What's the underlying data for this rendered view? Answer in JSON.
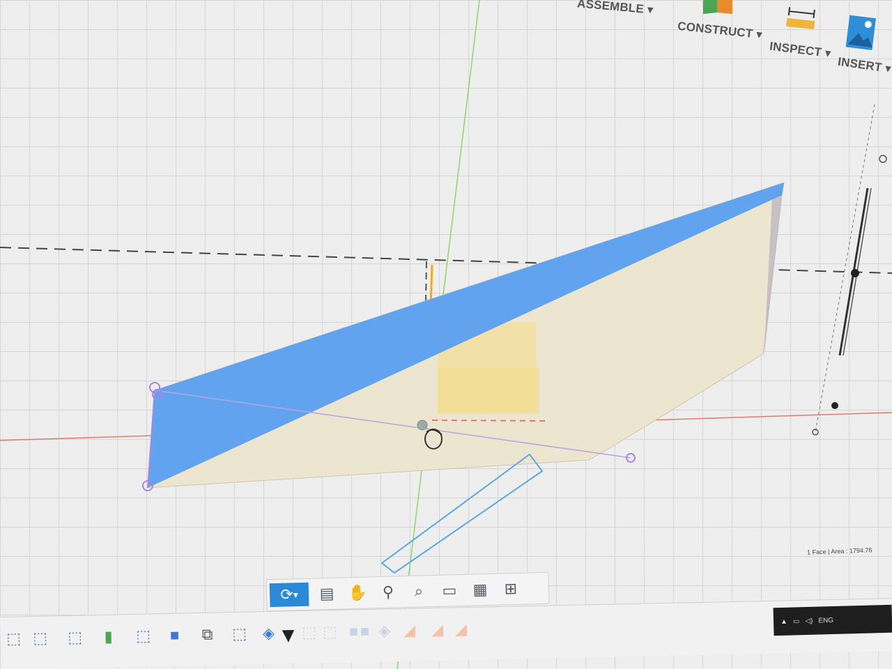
{
  "ribbon": {
    "items": [
      {
        "label": "ASSEMBLE",
        "icon": "assemble-icon"
      },
      {
        "label": "CONSTRUCT",
        "icon": "construct-plane-icon"
      },
      {
        "label": "INSPECT",
        "icon": "measure-ruler-icon"
      },
      {
        "label": "INSERT",
        "icon": "insert-image-icon"
      }
    ],
    "dropdown_glyph": "▾"
  },
  "viewport": {
    "status_text": "1 Face | Area : 1794.76",
    "colors": {
      "highlight_face": "#5b9ff0",
      "body": "#ece6d0",
      "sketch_yellow": "#f5dc8e",
      "x_axis": "#e07a70",
      "y_axis": "#8fd66a",
      "z_axis": "#3b7be0"
    }
  },
  "nav_bar": {
    "buttons": [
      {
        "name": "orbit-button",
        "icon": "orbit-icon"
      },
      {
        "name": "look-at-button",
        "icon": "look-at-icon"
      },
      {
        "name": "pan-button",
        "icon": "pan-hand-icon"
      },
      {
        "name": "zoom-button",
        "icon": "zoom-icon"
      },
      {
        "name": "fit-button",
        "icon": "fit-zoom-icon"
      },
      {
        "name": "display-settings-button",
        "icon": "display-icon"
      },
      {
        "name": "grid-settings-button",
        "icon": "grid-icon"
      },
      {
        "name": "viewports-button",
        "icon": "viewports-icon"
      }
    ]
  },
  "timeline": {
    "items": [
      "sketch-icon",
      "sketch-icon",
      "sketch-icon",
      "extrude-icon",
      "sketch-icon",
      "box-icon",
      "joint-icon",
      "sketch-icon",
      "loft-icon",
      "marker-icon",
      "faded-sketch-icon",
      "faded-sketch-icon",
      "faded-box-icon",
      "faded-box-icon",
      "faded-loft-icon",
      "faded-fillet-icon",
      "faded-plane-icon",
      "faded-plane-icon"
    ]
  },
  "taskbar": {
    "lang": "ENG"
  }
}
